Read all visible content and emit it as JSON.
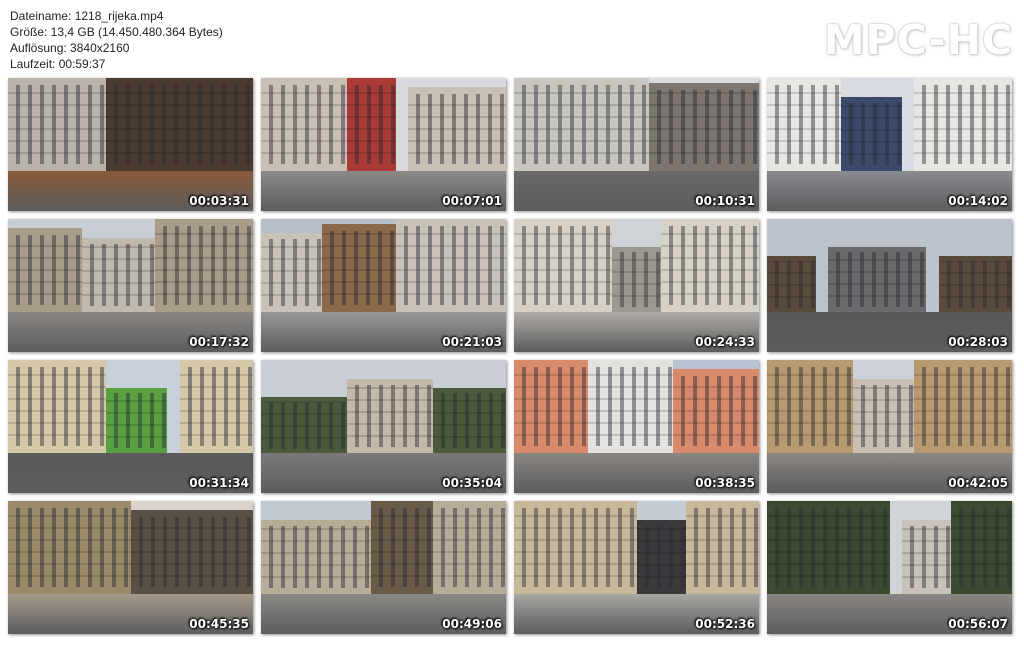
{
  "file_info": {
    "name_line": "Dateiname: 1218_rijeka.mp4",
    "size_line": "Größe: 13,4 GB (14.450.480.364 Bytes)",
    "resolution_line": "Auflösung: 3840x2160",
    "duration_line": "Laufzeit: 00:59:37"
  },
  "logo": "MPC-HC",
  "thumbnails": [
    {
      "time": "00:03:31",
      "palette": [
        "#6a6f74",
        "#b9b3ab",
        "#4a3a30",
        "#8a5a3a"
      ]
    },
    {
      "time": "00:07:01",
      "palette": [
        "#d7d9de",
        "#c8c0b4",
        "#a93a36",
        "#8c8a88"
      ]
    },
    {
      "time": "00:10:31",
      "palette": [
        "#d8dade",
        "#c9c6c0",
        "#7d7670",
        "#6b6a68"
      ]
    },
    {
      "time": "00:14:02",
      "palette": [
        "#d8dce2",
        "#e8e6e2",
        "#3a4a6a",
        "#8a8c90"
      ]
    },
    {
      "time": "00:17:32",
      "palette": [
        "#c9cdd4",
        "#a99c88",
        "#c0b9ae",
        "#8a8682"
      ]
    },
    {
      "time": "00:21:03",
      "palette": [
        "#b8bec8",
        "#c8c2b8",
        "#8a6a4a",
        "#9a9896"
      ]
    },
    {
      "time": "00:24:33",
      "palette": [
        "#cfd3d8",
        "#d8d2c6",
        "#9c9890",
        "#b0aca6"
      ]
    },
    {
      "time": "00:28:03",
      "palette": [
        "#bcc3cc",
        "#5a4a3a",
        "#6a6a6c",
        "#58585a"
      ]
    },
    {
      "time": "00:31:34",
      "palette": [
        "#c8d0da",
        "#d4c8a8",
        "#5aa040",
        "#5a5a5c"
      ]
    },
    {
      "time": "00:35:04",
      "palette": [
        "#c8cdd6",
        "#4a5a3a",
        "#c4b8a8",
        "#7a7a78"
      ]
    },
    {
      "time": "00:38:35",
      "palette": [
        "#b8c2d0",
        "#d88a6a",
        "#e4e2de",
        "#8a8682"
      ]
    },
    {
      "time": "00:42:05",
      "palette": [
        "#cdd2d8",
        "#b89a70",
        "#c8bfb2",
        "#8c8884"
      ]
    },
    {
      "time": "00:45:35",
      "palette": [
        "#d8d4cc",
        "#9a8a6a",
        "#5a5046",
        "#a69a88"
      ]
    },
    {
      "time": "00:49:06",
      "palette": [
        "#c2c8d0",
        "#b8ac98",
        "#6a5a48",
        "#8a8884"
      ]
    },
    {
      "time": "00:52:36",
      "palette": [
        "#c6ccd4",
        "#c8b89a",
        "#3a3a3c",
        "#a8a6a2"
      ]
    },
    {
      "time": "00:56:07",
      "palette": [
        "#d0d4d8",
        "#3c4a32",
        "#c8c2b8",
        "#8a8682"
      ]
    }
  ]
}
